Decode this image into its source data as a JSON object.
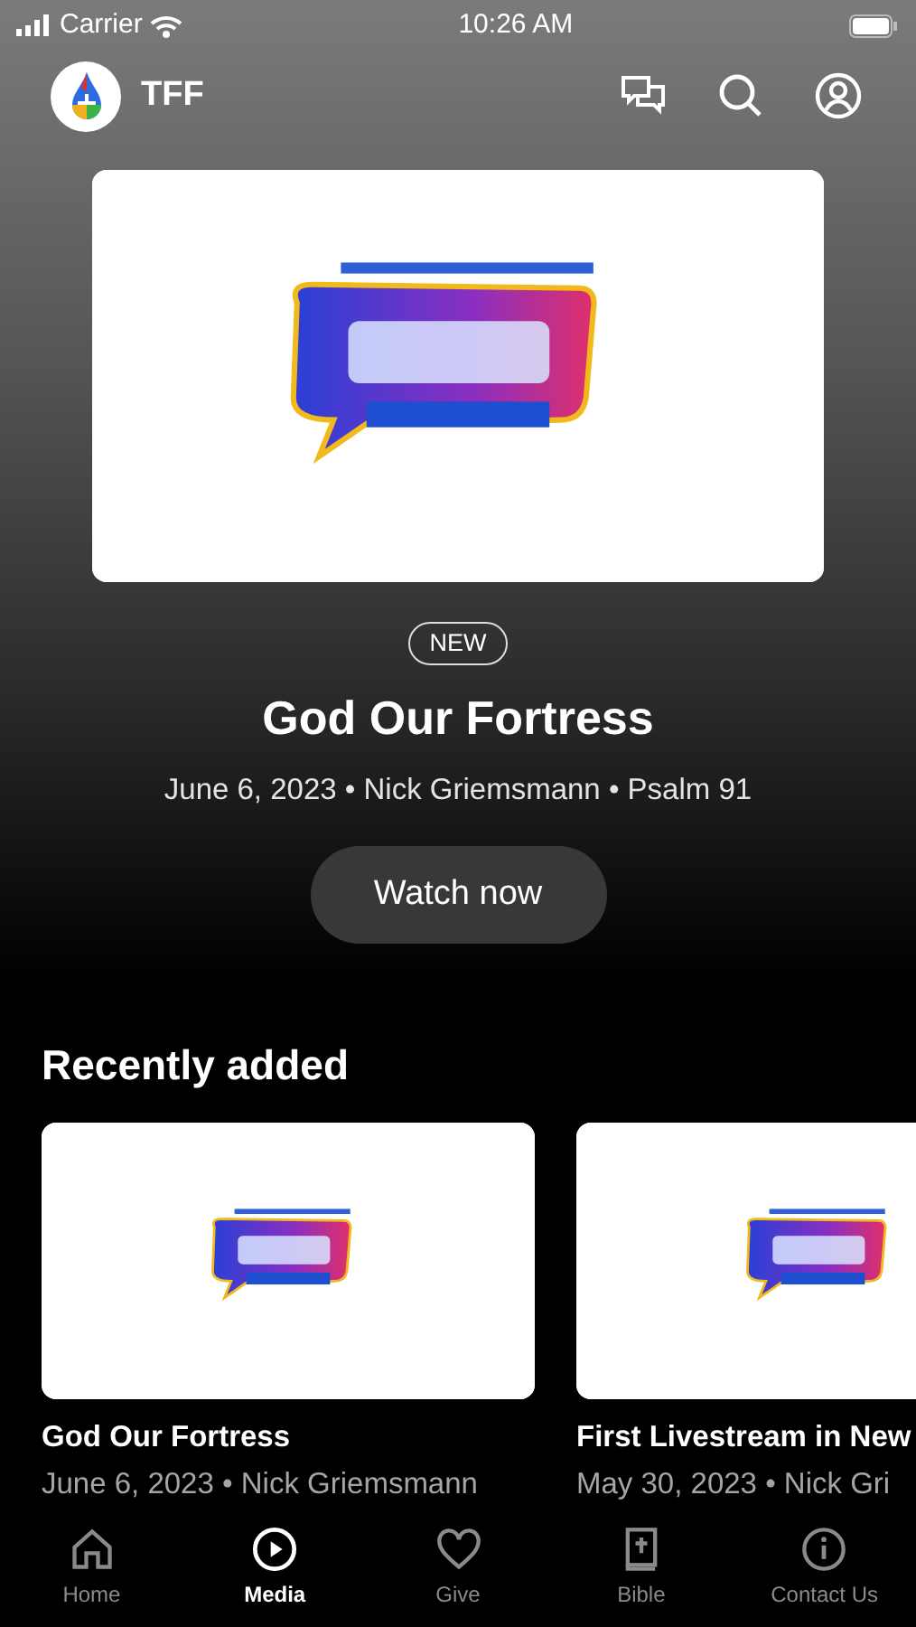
{
  "status_bar": {
    "carrier": "Carrier",
    "time": "10:26 AM"
  },
  "header": {
    "title": "TFF"
  },
  "featured": {
    "badge": "NEW",
    "title": "God Our Fortress",
    "meta": "June 6, 2023 • Nick Griemsmann • Psalm 91",
    "button": "Watch now"
  },
  "recently_added": {
    "heading": "Recently added",
    "items": [
      {
        "title": "God Our Fortress",
        "meta": "June 6, 2023 • Nick Griemsmann"
      },
      {
        "title": "First Livestream in New",
        "meta": "May 30, 2023 • Nick Gri"
      }
    ]
  },
  "tab_bar": [
    {
      "label": "Home",
      "selected": false
    },
    {
      "label": "Media",
      "selected": true
    },
    {
      "label": "Give",
      "selected": false
    },
    {
      "label": "Bible",
      "selected": false
    },
    {
      "label": "Contact Us",
      "selected": false
    }
  ]
}
